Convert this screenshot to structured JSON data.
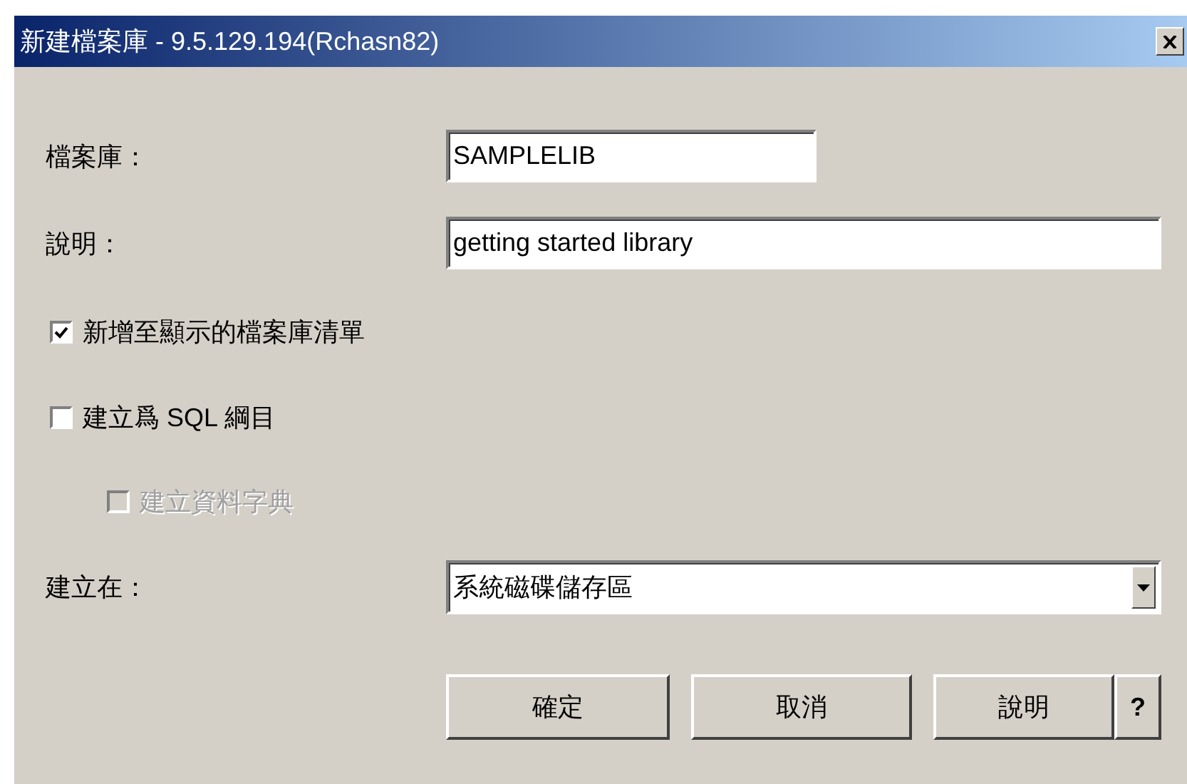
{
  "window": {
    "title": "新建檔案庫 - 9.5.129.194(Rchasn82)"
  },
  "fields": [
    {
      "label": "檔案庫：",
      "value": "SAMPLELIB",
      "kind": "short"
    },
    {
      "label": "說明：",
      "value": "getting started library",
      "kind": "wide"
    }
  ],
  "checkboxes": [
    {
      "label": "新增至顯示的檔案庫清單",
      "checked": true,
      "disabled": false
    },
    {
      "label": "建立爲 SQL 綱目",
      "checked": false,
      "disabled": false,
      "children": [
        {
          "label": "建立資料字典",
          "checked": false,
          "disabled": true
        }
      ]
    }
  ],
  "location": {
    "label": "建立在：",
    "value": "系統磁碟儲存區"
  },
  "buttons": [
    "確定",
    "取消",
    "說明"
  ],
  "help_button": "?"
}
